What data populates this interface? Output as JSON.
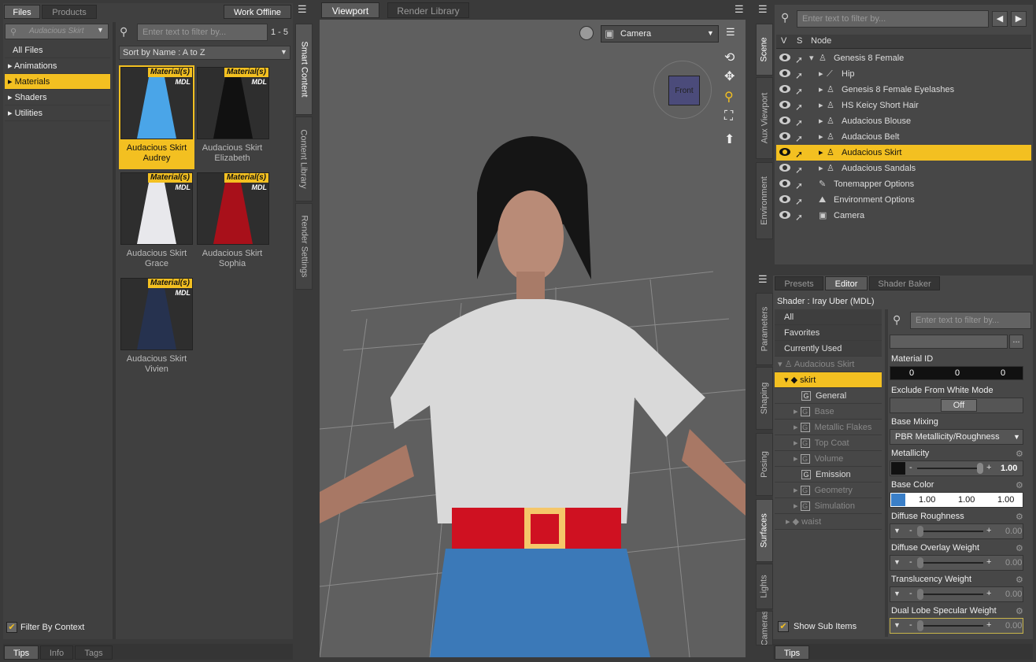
{
  "left_panel": {
    "tabs": [
      "Files",
      "Products"
    ],
    "work_offline": "Work Offline",
    "context_filter": "Audacious Skirt",
    "categories": [
      "All Files",
      "Animations",
      "Materials",
      "Shaders",
      "Utilities"
    ],
    "selected_category": "Materials",
    "filter_by_context": "Filter By Context",
    "bottom_tabs": [
      "Tips",
      "Info",
      "Tags"
    ]
  },
  "content": {
    "search_placeholder": "Enter text to filter by...",
    "count": "1 - 5",
    "sort": "Sort by Name : A to Z",
    "badge": "Material(s)",
    "mdl": "MDL",
    "items": [
      {
        "label1": "Audacious Skirt",
        "label2": "Audrey",
        "color": "#4aa5e8"
      },
      {
        "label1": "Audacious Skirt",
        "label2": "Elizabeth",
        "color": "#111111"
      },
      {
        "label1": "Audacious Skirt",
        "label2": "Grace",
        "color": "#e8e8ec"
      },
      {
        "label1": "Audacious Skirt",
        "label2": "Sophia",
        "color": "#a8101a"
      },
      {
        "label1": "Audacious Skirt",
        "label2": "Vivien",
        "color": "#26324f"
      }
    ]
  },
  "vertical_tabs_left": [
    "Smart Content",
    "Content Library",
    "Render Settings"
  ],
  "viewport": {
    "tabs": [
      "Viewport",
      "Render Library"
    ],
    "camera": "Camera",
    "cube_face": "Front"
  },
  "scene": {
    "search_placeholder": "Enter text to filter by...",
    "headers": {
      "v": "V",
      "s": "S",
      "node": "Node"
    },
    "nodes": [
      "Genesis 8 Female",
      "Hip",
      "Genesis 8 Female Eyelashes",
      "HS Keicy Short Hair",
      "Audacious Blouse",
      "Audacious Belt",
      "Audacious Skirt",
      "Audacious Sandals",
      "Tonemapper Options",
      "Environment Options",
      "Camera"
    ],
    "selected": "Audacious Skirt"
  },
  "vertical_tabs_right_top": [
    "Scene",
    "Aux Viewport",
    "Environment"
  ],
  "vertical_tabs_right_bottom": [
    "Parameters",
    "Shaping",
    "Posing",
    "Surfaces",
    "Lights",
    "Cameras"
  ],
  "surfaces": {
    "tabs": [
      "Presets",
      "Editor",
      "Shader Baker"
    ],
    "shader": "Shader : Iray Uber (MDL)",
    "filters": [
      "All",
      "Favorites",
      "Currently Used"
    ],
    "tree_root": "Audacious Skirt",
    "tree_skirt": "skirt",
    "groups": [
      "General",
      "Base",
      "Metallic Flakes",
      "Top Coat",
      "Volume",
      "Emission",
      "Geometry",
      "Simulation"
    ],
    "waist": "waist",
    "show_sub_items": "Show Sub Items",
    "search_placeholder": "Enter text to filter by...",
    "ellipsis": "...",
    "properties": {
      "material_id": {
        "label": "Material ID",
        "values": [
          "0",
          "0",
          "0"
        ]
      },
      "exclude_white": {
        "label": "Exclude From White Mode",
        "value": "Off"
      },
      "base_mixing": {
        "label": "Base Mixing",
        "value": "PBR Metallicity/Roughness"
      },
      "metallicity": {
        "label": "Metallicity",
        "value": "1.00"
      },
      "base_color": {
        "label": "Base Color",
        "values": [
          "1.00",
          "1.00",
          "1.00"
        ],
        "swatch": "#3a7fc8"
      },
      "diffuse_roughness": {
        "label": "Diffuse Roughness",
        "value": "0.00"
      },
      "diffuse_overlay": {
        "label": "Diffuse Overlay Weight",
        "value": "0.00"
      },
      "translucency": {
        "label": "Translucency Weight",
        "value": "0.00"
      },
      "dual_lobe": {
        "label": "Dual Lobe Specular Weight",
        "value": "0.00"
      }
    },
    "bottom_tab": "Tips"
  },
  "colors": {
    "accent": "#f3c021",
    "panel": "#4a4a4a",
    "dark": "#353535"
  }
}
